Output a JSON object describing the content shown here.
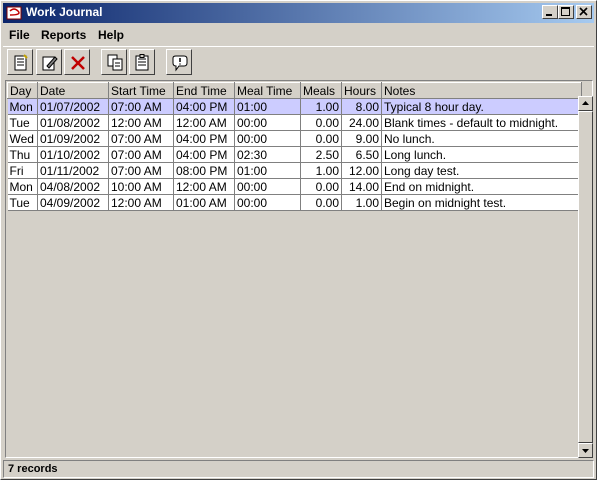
{
  "window": {
    "title": "Work Journal"
  },
  "menu": {
    "file": "File",
    "reports": "Reports",
    "help": "Help"
  },
  "toolbar": {
    "new_icon": "new-entry-icon",
    "edit_icon": "edit-entry-icon",
    "delete_icon": "delete-icon",
    "copy_icon": "copy-icon",
    "paste_icon": "paste-icon",
    "comment_icon": "comment-icon"
  },
  "table": {
    "headers": [
      "Day",
      "Date",
      "Start Time",
      "End Time",
      "Meal Time",
      "Meals",
      "Hours",
      "Notes"
    ],
    "rows": [
      [
        "Mon",
        "01/07/2002",
        "07:00 AM",
        "04:00 PM",
        "01:00",
        "1.00",
        "8.00",
        "Typical 8 hour day."
      ],
      [
        "Tue",
        "01/08/2002",
        "12:00 AM",
        "12:00 AM",
        "00:00",
        "0.00",
        "24.00",
        "Blank times - default to midnight."
      ],
      [
        "Wed",
        "01/09/2002",
        "07:00 AM",
        "04:00 PM",
        "00:00",
        "0.00",
        "9.00",
        "No lunch."
      ],
      [
        "Thu",
        "01/10/2002",
        "07:00 AM",
        "04:00 PM",
        "02:30",
        "2.50",
        "6.50",
        "Long lunch."
      ],
      [
        "Fri",
        "01/11/2002",
        "07:00 AM",
        "08:00 PM",
        "01:00",
        "1.00",
        "12.00",
        "Long day test."
      ],
      [
        "Mon",
        "04/08/2002",
        "10:00 AM",
        "12:00 AM",
        "00:00",
        "0.00",
        "14.00",
        "End on midnight."
      ],
      [
        "Tue",
        "04/09/2002",
        "12:00 AM",
        "01:00 AM",
        "00:00",
        "0.00",
        "1.00",
        "Begin on midnight test."
      ]
    ],
    "selected_row": 0
  },
  "status": {
    "text": "7 records"
  }
}
